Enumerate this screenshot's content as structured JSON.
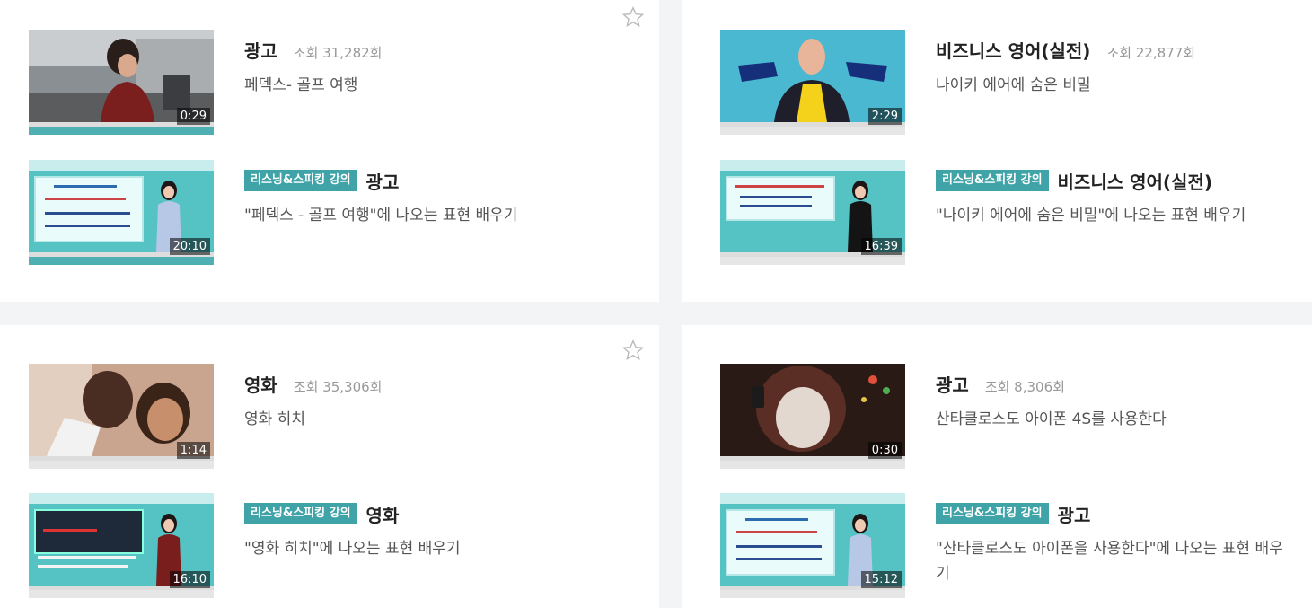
{
  "cards": [
    {
      "video": {
        "title": "광고",
        "views": "조회 31,282회",
        "subtitle": "페덱스- 골프 여행",
        "duration": "0:29"
      },
      "lecture": {
        "badge": "리스닝&스피킹 강의",
        "title": "광고",
        "subtitle": "\"페덱스 - 골프 여행\"에 나오는 표현 배우기",
        "duration": "20:10"
      },
      "has_star": true
    },
    {
      "video": {
        "title": "비즈니스 영어(실전)",
        "views": "조회 22,877회",
        "subtitle": "나이키 에어에 숨은 비밀",
        "duration": "2:29"
      },
      "lecture": {
        "badge": "리스닝&스피킹 강의",
        "title": "비즈니스 영어(실전)",
        "subtitle": "\"나이키 에어에 숨은 비밀\"에 나오는 표현 배우기",
        "duration": "16:39"
      },
      "has_star": false
    },
    {
      "video": {
        "title": "영화",
        "views": "조회 35,306회",
        "subtitle": "영화 히치",
        "duration": "1:14"
      },
      "lecture": {
        "badge": "리스닝&스피킹 강의",
        "title": "영화",
        "subtitle": "\"영화 히치\"에 나오는 표현 배우기",
        "duration": "16:10"
      },
      "has_star": true
    },
    {
      "video": {
        "title": "광고",
        "views": "조회 8,306회",
        "subtitle": "산타클로스도 아이폰 4S를 사용한다",
        "duration": "0:30"
      },
      "lecture": {
        "badge": "리스닝&스피킹 강의",
        "title": "광고",
        "subtitle": "\"산타클로스도 아이폰을 사용한다\"에 나오는 표현 배우기",
        "duration": "15:12"
      },
      "has_star": false
    }
  ],
  "colors": {
    "accent": "#3fa3a7",
    "background": "#f3f4f6",
    "card": "#ffffff"
  }
}
